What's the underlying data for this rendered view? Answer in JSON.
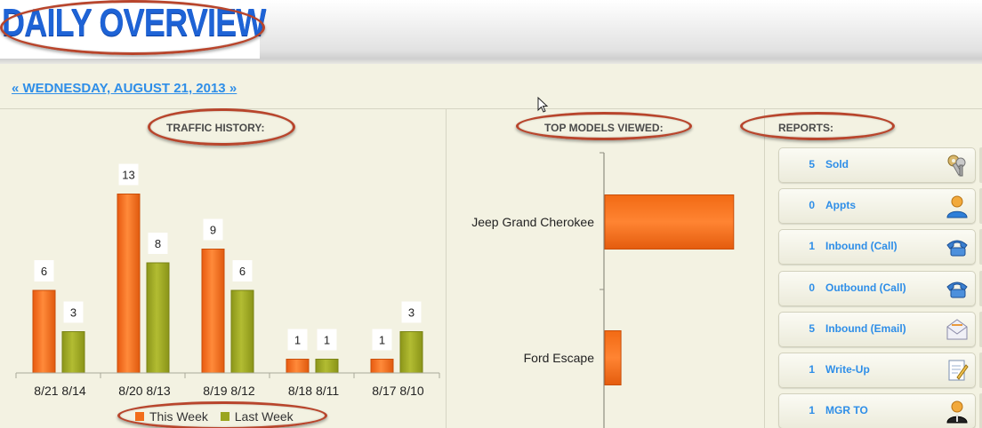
{
  "header": {
    "title": "DAILY OVERVIEW"
  },
  "date_nav": {
    "prev": "«",
    "label": "WEDNESDAY, AUGUST 21, 2013",
    "next": "»"
  },
  "sections": {
    "traffic": "TRAFFIC HISTORY:",
    "models": "TOP MODELS VIEWED:",
    "reports": "REPORTS:"
  },
  "colors": {
    "this_week": "#f26d1a",
    "last_week": "#9aa51f",
    "accent": "#2e8ee8",
    "highlight": "#b8452c"
  },
  "chart_data": [
    {
      "type": "bar",
      "title": "TRAFFIC HISTORY:",
      "categories": [
        "8/21 8/14",
        "8/20 8/13",
        "8/19 8/12",
        "8/18 8/11",
        "8/17 8/10"
      ],
      "series": [
        {
          "name": "This Week",
          "values": [
            6,
            13,
            9,
            1,
            1
          ]
        },
        {
          "name": "Last Week",
          "values": [
            3,
            8,
            6,
            1,
            3
          ]
        }
      ],
      "ylim": [
        0,
        15
      ],
      "legend": "bottom"
    },
    {
      "type": "bar",
      "orientation": "horizontal",
      "title": "TOP MODELS VIEWED:",
      "categories": [
        "Jeep Grand Cherokee",
        "Ford Escape"
      ],
      "values": [
        8,
        1
      ],
      "xlim": [
        0,
        10
      ]
    }
  ],
  "legend": {
    "this_week": "This Week",
    "last_week": "Last Week"
  },
  "reports": [
    {
      "count": "5",
      "label": "Sold",
      "icon": "keys-icon"
    },
    {
      "count": "0",
      "label": "Appts",
      "icon": "person-icon"
    },
    {
      "count": "1",
      "label": "Inbound (Call)",
      "icon": "phone-icon"
    },
    {
      "count": "0",
      "label": "Outbound (Call)",
      "icon": "phone-icon"
    },
    {
      "count": "5",
      "label": "Inbound (Email)",
      "icon": "email-icon"
    },
    {
      "count": "1",
      "label": "Write-Up",
      "icon": "document-icon"
    },
    {
      "count": "1",
      "label": "MGR TO",
      "icon": "manager-icon"
    }
  ]
}
